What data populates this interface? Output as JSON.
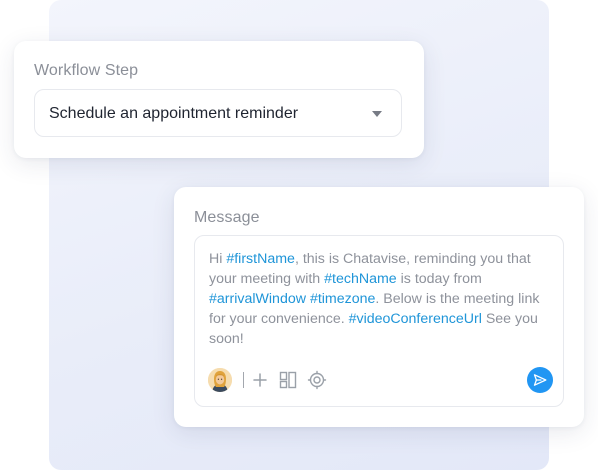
{
  "workflow": {
    "title": "Workflow Step",
    "selected_value": "Schedule an appointment reminder"
  },
  "message": {
    "title": "Message",
    "segments": [
      {
        "text": "Hi ",
        "tag": false
      },
      {
        "text": "#firstName",
        "tag": true
      },
      {
        "text": ", this is Chatavise, reminding you that your meeting with ",
        "tag": false
      },
      {
        "text": "#techName",
        "tag": true
      },
      {
        "text": " is today from ",
        "tag": false
      },
      {
        "text": "#arrivalWindow",
        "tag": true
      },
      {
        "text": " ",
        "tag": false
      },
      {
        "text": "#timezone",
        "tag": true
      },
      {
        "text": ". Below is the meeting link for your convenience. ",
        "tag": false
      },
      {
        "text": "#videoConferenceUrl",
        "tag": true
      },
      {
        "text": " See you soon!",
        "tag": false
      }
    ],
    "toolbar_icons": [
      "avatar",
      "plus-icon",
      "template-grid-icon",
      "target-icon",
      "send-icon"
    ]
  },
  "colors": {
    "tag": "#1f95d8",
    "send_button": "#2196f3",
    "body_text": "#8e929b",
    "title_text": "#8b8f98"
  }
}
